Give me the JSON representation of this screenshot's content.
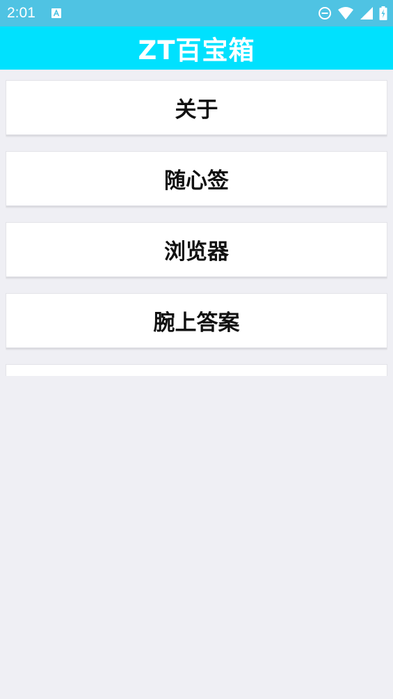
{
  "status_bar": {
    "time": "2:01",
    "left_icons": [
      "a-notification-icon"
    ],
    "right_icons": [
      "do-not-disturb-icon",
      "wifi-icon",
      "signal-icon",
      "battery-icon"
    ]
  },
  "app_bar": {
    "title": "ZT百宝箱",
    "color": "#00e1fe"
  },
  "menu": {
    "items": [
      {
        "label": "关于"
      },
      {
        "label": "随心签"
      },
      {
        "label": "浏览器"
      },
      {
        "label": "腕上答案"
      },
      {
        "label": ""
      }
    ]
  },
  "colors": {
    "status_bar": "#4fc3e3",
    "background": "#efeff4",
    "card": "#ffffff"
  }
}
